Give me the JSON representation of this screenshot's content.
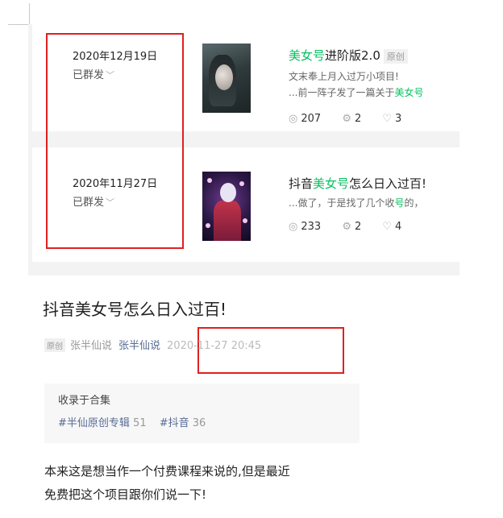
{
  "articles": [
    {
      "date": "2020年12月19日",
      "status": "已群发",
      "title_highlight": "美女号",
      "title_rest": "进阶版2.0",
      "tag": "原创",
      "desc_line1": "文末奉上月入过万小项目!",
      "desc_line2_pre": "...前一阵子发了一篇关于",
      "desc_line2_highlight": "美女号",
      "views": "207",
      "shares": "2",
      "likes": "3"
    },
    {
      "date": "2020年11月27日",
      "status": "已群发",
      "title_pre": "抖音",
      "title_highlight": "美女号",
      "title_rest": "怎么日入过百!",
      "desc_pre": "...做了，于是找了几个收",
      "desc_highlight": "号",
      "desc_post": "的，",
      "views": "233",
      "shares": "2",
      "likes": "4"
    }
  ],
  "article": {
    "title": "抖音美女号怎么日入过百!",
    "original_badge": "原创",
    "author": "张半仙说",
    "account": "张半仙说",
    "publish_time": "2020-11-27 20:45",
    "collection_label": "收录于合集",
    "collections": [
      {
        "name": "#半仙原创专辑",
        "count": "51"
      },
      {
        "name": "#抖音",
        "count": "36"
      }
    ],
    "body_line1": "本来这是想当作一个付费课程来说的,但是最近",
    "body_line2": "免费把这个项目跟你们说一下!"
  },
  "icons": {
    "view": "eye-icon",
    "share": "share-icon",
    "like": "thumbs-up-icon",
    "chevron": "chevron-down-icon"
  },
  "colors": {
    "accent_green": "#07c160",
    "link_blue": "#576b95",
    "highlight_red": "#e02020"
  }
}
